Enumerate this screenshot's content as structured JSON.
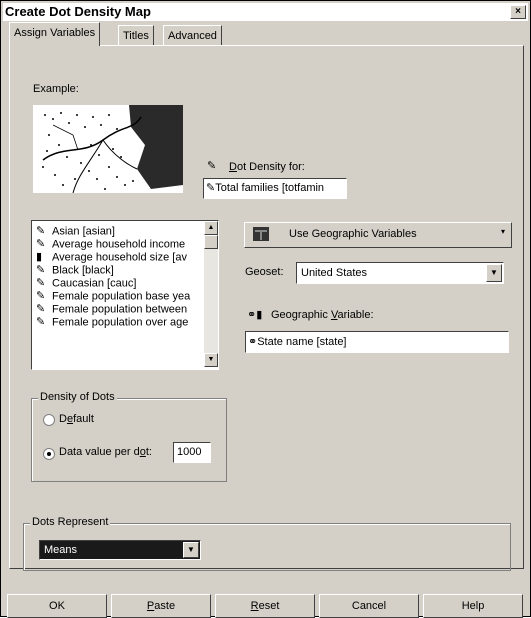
{
  "window": {
    "title": "Create Dot Density Map",
    "close": "×"
  },
  "tabs": [
    {
      "label": "Assign Variables",
      "active": true
    },
    {
      "label": "Titles",
      "active": false
    },
    {
      "label": "Advanced",
      "active": false
    }
  ],
  "example": {
    "label": "Example:"
  },
  "dot_density_for": {
    "label_prefix": "D",
    "label_rest": "ot Density for:",
    "value": "Total families [totfamin"
  },
  "variables": {
    "items": [
      {
        "label": "Asian [asian]",
        "icon": "scale-icon"
      },
      {
        "label": "Average household income",
        "icon": "scale-icon"
      },
      {
        "label": "Average household size [av",
        "icon": "bar-chart-icon"
      },
      {
        "label": "Black [black]",
        "icon": "scale-icon"
      },
      {
        "label": "Caucasian [cauc]",
        "icon": "scale-icon"
      },
      {
        "label": "Female population base yea",
        "icon": "scale-icon"
      },
      {
        "label": "Female population between",
        "icon": "scale-icon"
      },
      {
        "label": "Female population over age",
        "icon": "scale-icon"
      }
    ]
  },
  "geo_source": {
    "label": "Use Geographic Variables"
  },
  "geoset": {
    "label": "Geoset:",
    "value": "United States"
  },
  "geographic_variable": {
    "label_before": "Geographic ",
    "label_underlined": "V",
    "label_after": "ariable:",
    "value": "State name [state]"
  },
  "density": {
    "title": "Density of Dots",
    "default_prefix": "D",
    "default_underlined": "e",
    "default_rest": "fault",
    "data_value_prefix": "Data value per d",
    "data_value_underlined": "o",
    "data_value_suffix": "t:",
    "data_value": "1000",
    "selected": "data_value"
  },
  "dots_represent": {
    "title": "Dots Represent",
    "value": "Means"
  },
  "buttons": {
    "ok": "OK",
    "paste_u": "P",
    "paste_rest": "aste",
    "reset_u": "R",
    "reset_rest": "eset",
    "cancel": "Cancel",
    "help": "Help"
  }
}
